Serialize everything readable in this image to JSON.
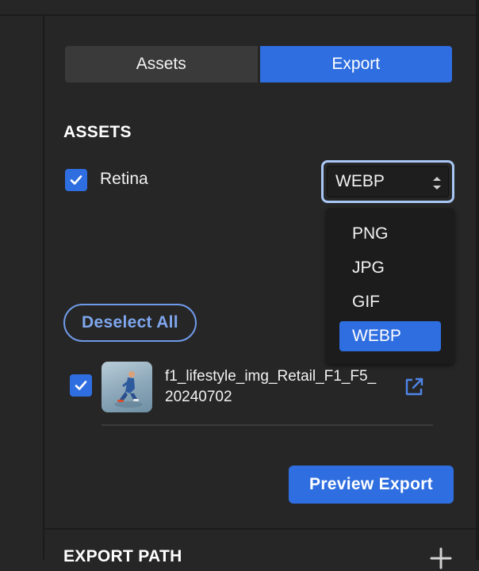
{
  "tabs": [
    {
      "label": "Assets",
      "active": false
    },
    {
      "label": "Export",
      "active": true
    }
  ],
  "assets_section": {
    "heading": "ASSETS",
    "retina": {
      "label": "Retina",
      "checked": true
    },
    "format_select": {
      "value": "WEBP",
      "options": [
        "PNG",
        "JPG",
        "GIF",
        "WEBP"
      ],
      "selected_index": 3
    },
    "deselect_all_label": "Deselect All",
    "items": [
      {
        "name_line1": "f1_lifestyle_img_Retail_F1_F5_",
        "name_line2": "20240702",
        "checked": true,
        "icon": "open-external-icon"
      }
    ],
    "preview_export_label": "Preview Export"
  },
  "export_path": {
    "heading": "EXPORT PATH",
    "icon": "plus-icon"
  },
  "colors": {
    "accent": "#2f6ee0",
    "background": "#262626",
    "focus_ring": "#a9c7f5"
  }
}
